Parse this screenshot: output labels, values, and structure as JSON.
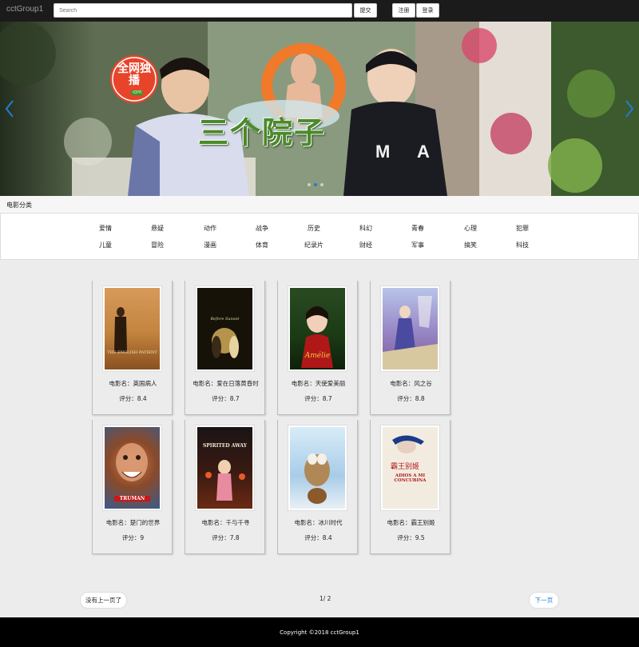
{
  "navbar": {
    "brand": "cctGroup1",
    "search_placeholder": "Search",
    "submit_label": "提交",
    "register_label": "注册",
    "login_label": "登录"
  },
  "carousel": {
    "banner_text": "三个院子",
    "badge_text": "全网独播",
    "badge_sub": "iQIYI",
    "slide_count": 3,
    "active_slide": 2
  },
  "categories": {
    "title": "电影分类",
    "row1": [
      "爱情",
      "悬疑",
      "动作",
      "战争",
      "历史",
      "科幻",
      "青春",
      "心理",
      "犯罪"
    ],
    "row2": [
      "儿童",
      "冒险",
      "漫画",
      "体育",
      "纪录片",
      "财经",
      "军事",
      "搞笑",
      "科技"
    ]
  },
  "movies": [
    {
      "name": "电影名：英国病人",
      "score": "评分：8.4",
      "poster_text": "THE ENGLISH PATIENT",
      "poster_color": "#c98a4a"
    },
    {
      "name": "电影名：爱在日落黄昏时",
      "score": "评分：8.7",
      "poster_text": "Before Sunset",
      "poster_color": "#1a1408"
    },
    {
      "name": "电影名：天使爱美丽",
      "score": "评分：8.7",
      "poster_text": "Amélie",
      "poster_color": "#1f3a1a"
    },
    {
      "name": "电影名：风之谷",
      "score": "评分：8.8",
      "poster_text": "",
      "poster_color": "#8a7ab8"
    },
    {
      "name": "电影名：楚门的世界",
      "score": "评分：9",
      "poster_text": "TRUMAN",
      "poster_color": "#6a3a2a"
    },
    {
      "name": "电影名：千与千寻",
      "score": "评分：7.8",
      "poster_text": "SPIRITED AWAY",
      "poster_color": "#1a1a1a"
    },
    {
      "name": "电影名：冰川时代",
      "score": "评分：8.4",
      "poster_text": "",
      "poster_color": "#bcd8ec"
    },
    {
      "name": "电影名：霸王别姬",
      "score": "评分：9.5",
      "poster_text": "ADIOS A MI CONCUBINA",
      "poster_color": "#f0e8d8"
    }
  ],
  "pagination": {
    "prev_label": "没有上一页了",
    "page_info": "1/ 2",
    "next_label": "下一页"
  },
  "footer": {
    "copyright": "Copyright ©2018 cctGroup1"
  },
  "colors": {
    "navbar_bg": "#1b1b1b",
    "accent": "#1e7ed4",
    "footer_bg": "#000000"
  }
}
